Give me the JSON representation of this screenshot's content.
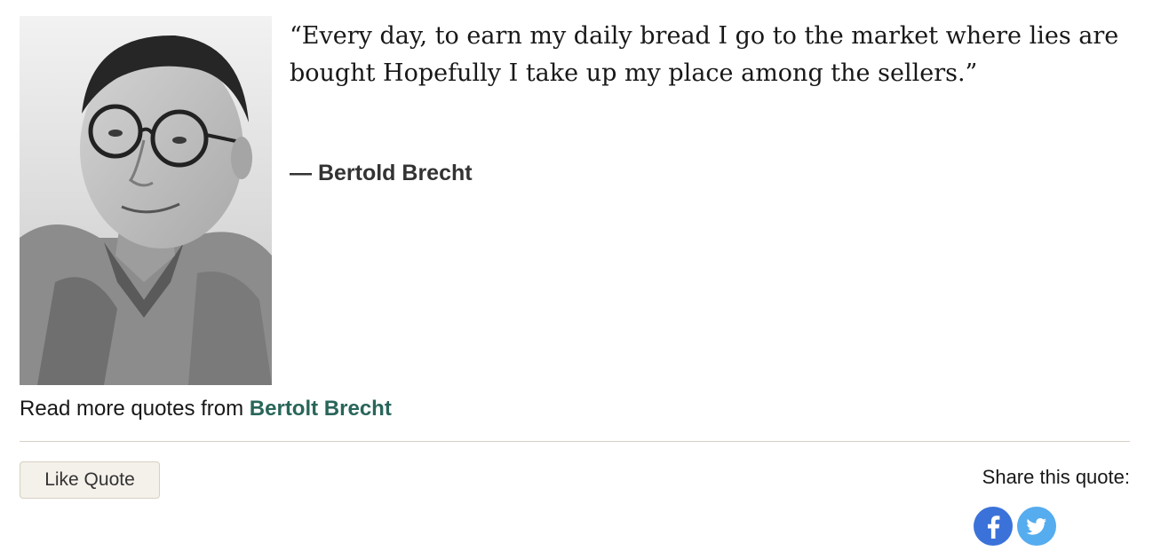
{
  "quote": {
    "text": "“Every day, to earn my daily bread I go to the market where lies are bought Hopefully I take up my place among the sellers.”",
    "author_line": "― Bertold Brecht"
  },
  "read_more": {
    "prefix": "Read more quotes from ",
    "author_link": "Bertolt Brecht"
  },
  "actions": {
    "like_label": "Like Quote",
    "share_label": "Share this quote:"
  },
  "share": [
    {
      "icon": "facebook-icon",
      "color": "#3b72d9"
    },
    {
      "icon": "twitter-icon",
      "color": "#55acee"
    }
  ],
  "colors": {
    "link": "#29665a",
    "button_bg": "#f4f1ea",
    "divider": "#d6d0c4"
  }
}
